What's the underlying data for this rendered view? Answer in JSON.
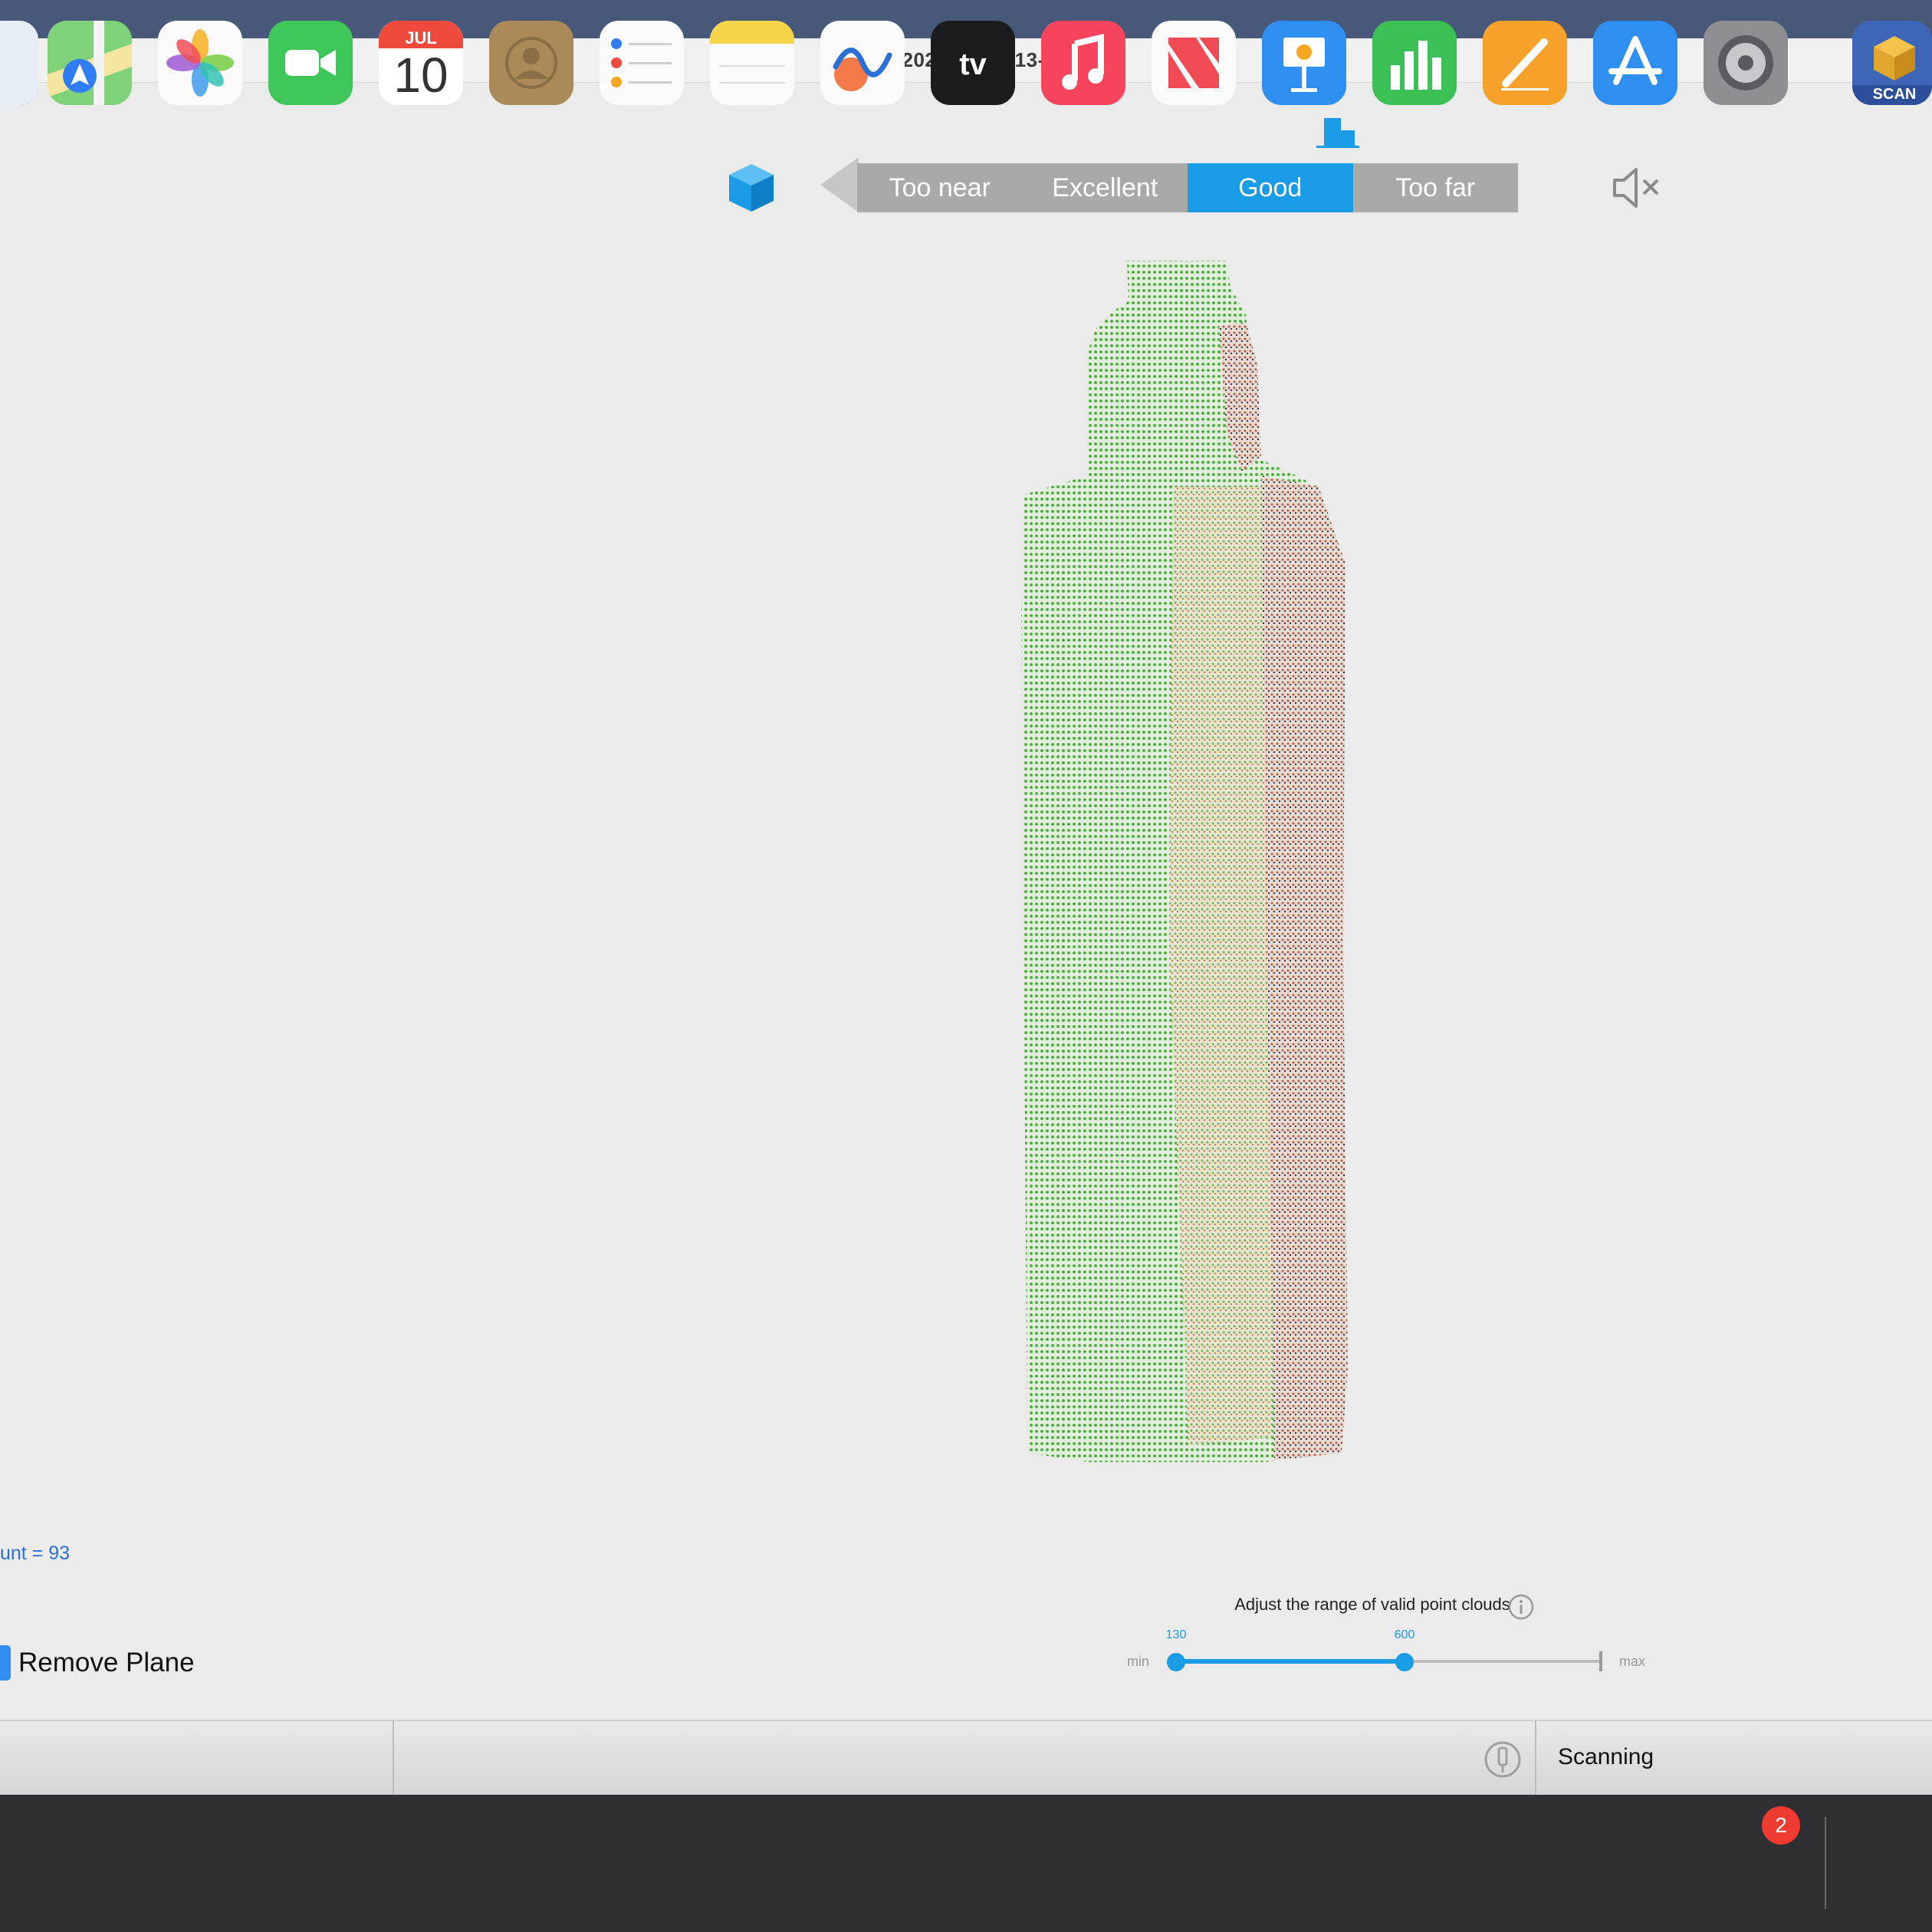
{
  "window": {
    "title": "model-2023-07-10-13-14-22"
  },
  "distance_indicator": {
    "segments": [
      {
        "label": "Too near",
        "active": false
      },
      {
        "label": "Excellent",
        "active": false
      },
      {
        "label": "Good",
        "active": true
      },
      {
        "label": "Too far",
        "active": false
      }
    ],
    "active_color": "#1a9be6"
  },
  "icons": {
    "cube": "3d-cube-icon",
    "mute": "speaker-muted-icon",
    "info": "info-icon",
    "status": "probe-icon"
  },
  "count_label": "unt = 93",
  "remove_plane": {
    "label": "Remove Plane"
  },
  "point_range": {
    "title": "Adjust the range of valid point clouds",
    "min_label": "min",
    "max_label": "max",
    "low_value": "130",
    "high_value": "600"
  },
  "status": {
    "text": "Scanning"
  },
  "dock": {
    "apps": [
      "Finder",
      "Maps",
      "Photos",
      "FaceTime",
      "Calendar",
      "Contacts",
      "Reminders",
      "Notes",
      "Freeform",
      "TV",
      "Music",
      "News",
      "Keynote",
      "Numbers",
      "Pages",
      "App Store",
      "System Settings",
      "Scan"
    ],
    "calendar": {
      "month": "JUL",
      "day": "10"
    },
    "settings_badge": "2",
    "scan_label": "SCAN"
  }
}
